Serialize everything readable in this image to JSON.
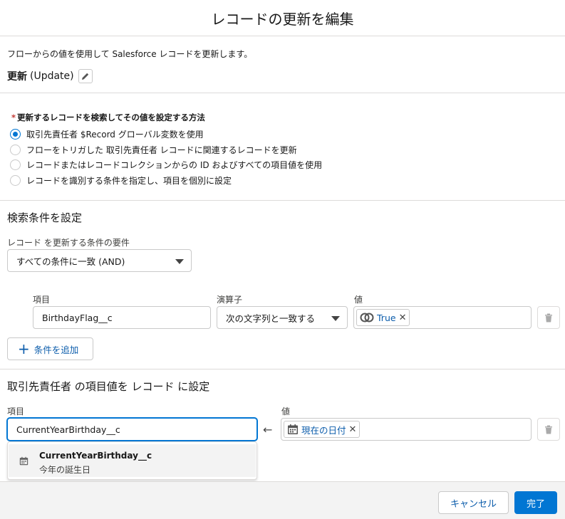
{
  "modal": {
    "title": "レコードの更新を編集"
  },
  "description": "フローからの値を使用して Salesforce レコードを更新します。",
  "element": {
    "label": "更新",
    "api_name": "(Update)",
    "edit_icon": "pencil-icon"
  },
  "how_to": {
    "required_marker": "*",
    "legend": "更新するレコードを検索してその値を設定する方法",
    "options": [
      {
        "label": "取引先責任者 $Record グローバル変数を使用",
        "selected": true
      },
      {
        "label": "フローをトリガした 取引先責任者 レコードに関連するレコードを更新",
        "selected": false
      },
      {
        "label": "レコードまたはレコードコレクションからの ID およびすべての項目値を使用",
        "selected": false
      },
      {
        "label": "レコードを識別する条件を指定し、項目を個別に設定",
        "selected": false
      }
    ]
  },
  "filter": {
    "heading": "検索条件を設定",
    "requirement_label": "レコード を更新する条件の要件",
    "requirement_value": "すべての条件に一致 (AND)",
    "field_label": "項目",
    "operator_label": "演算子",
    "value_label": "値",
    "condition": {
      "field": "BirthdayFlag__c",
      "operator": "次の文字列と一致する",
      "value": "True",
      "value_icon": "boolean-toggle-icon"
    },
    "add_condition": "条件を追加"
  },
  "set_values": {
    "heading": "取引先責任者 の項目値を レコード に設定",
    "field_label": "項目",
    "value_label": "値",
    "field_input": "CurrentYearBirthday__c",
    "value": "現在の日付",
    "value_icon": "calendar-icon"
  },
  "autocomplete": {
    "item_api": "CurrentYearBirthday__c",
    "item_label": "今年の誕生日",
    "item_icon": "calendar-icon"
  },
  "footer": {
    "cancel": "キャンセル",
    "done": "完了"
  },
  "colors": {
    "brand": "#0176d3",
    "link": "#0b5cab",
    "border": "#c9c9c9",
    "footer_bg": "#f3f3f3"
  }
}
